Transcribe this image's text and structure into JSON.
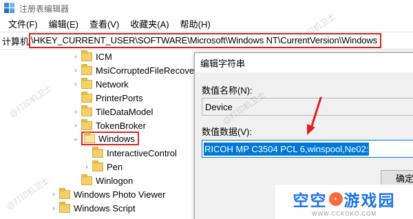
{
  "window": {
    "title": "注册表编辑器"
  },
  "menu": {
    "items": [
      "文件(F)",
      "编辑(E)",
      "查看(V)",
      "收藏夹(A)",
      "帮助(H)"
    ]
  },
  "address": {
    "prefix": "计算机",
    "path": "\\HKEY_CURRENT_USER\\SOFTWARE\\Microsoft\\Windows NT\\CurrentVersion\\Windows"
  },
  "tree": {
    "items": [
      {
        "label": "ICM"
      },
      {
        "label": "MsiCorruptedFileRecove"
      },
      {
        "label": "Network"
      },
      {
        "label": "PrinterPorts"
      },
      {
        "label": "TileDataModel"
      },
      {
        "label": "TokenBroker"
      },
      {
        "label": "Windows"
      },
      {
        "label": "InteractiveControl"
      },
      {
        "label": "Pen"
      },
      {
        "label": "Winlogon"
      },
      {
        "label": "Windows Photo Viewer"
      },
      {
        "label": "Windows Script"
      }
    ]
  },
  "dialog": {
    "title": "编辑字符串",
    "name_label": "数值名称(N):",
    "name_value": "Device",
    "data_label": "数值数据(V):",
    "data_value": "RICOH MP C3504 PCL 6,winspool,Ne02:",
    "ok_label": "确定"
  },
  "logo": {
    "text_left": "空空",
    "text_right": "游戏园",
    "sub": "WWW.CCKOKO.COM"
  },
  "watermark": {
    "text": "@打印机卫士"
  },
  "colors": {
    "highlight_red": "#e0201c",
    "selection_blue": "#0078d7",
    "folder_yellow": "#f4cf6b"
  }
}
